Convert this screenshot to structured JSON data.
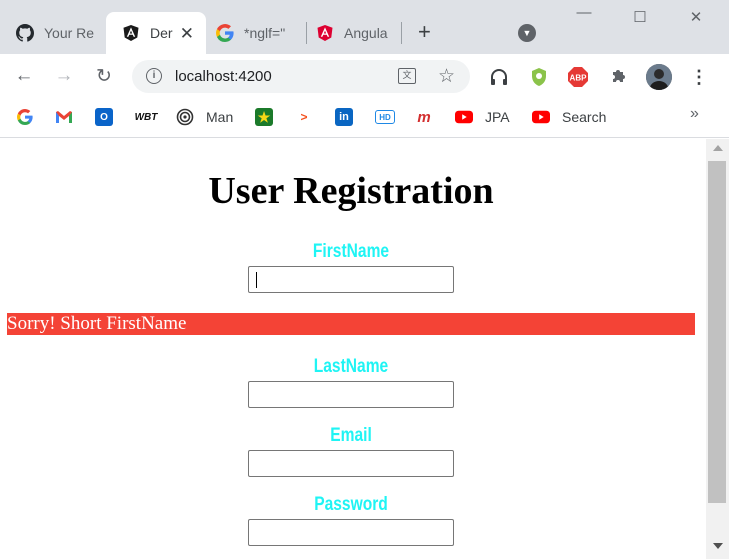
{
  "browser": {
    "tabs": [
      {
        "title": "Your Re",
        "icon": "github-icon"
      },
      {
        "title": "Der",
        "icon": "angular-icon",
        "active": true
      },
      {
        "title": "*nglf=\"",
        "icon": "google-icon"
      },
      {
        "title": "Angula",
        "icon": "angular-red-icon"
      }
    ],
    "address": {
      "url": "localhost:4200"
    },
    "bookmarks": [
      {
        "label": "",
        "icon": "google-icon"
      },
      {
        "label": "",
        "icon": "gmail-icon"
      },
      {
        "label": "",
        "icon": "outlook-icon"
      },
      {
        "label": "",
        "icon": "wbt-icon"
      },
      {
        "label": "Man",
        "icon": "spiral-icon"
      },
      {
        "label": "",
        "icon": "star-badge-icon"
      },
      {
        "label": "",
        "icon": "code-icon"
      },
      {
        "label": "",
        "icon": "linkedin-icon"
      },
      {
        "label": "",
        "icon": "hd-icon"
      },
      {
        "label": "",
        "icon": "m-icon"
      },
      {
        "label": "JPA",
        "icon": "youtube-icon"
      },
      {
        "label": "Search",
        "icon": "youtube-icon"
      }
    ],
    "bookmarks_more": "»"
  },
  "page": {
    "title": "User Registration",
    "fields": {
      "firstname": {
        "label": "FirstName",
        "value": ""
      },
      "lastname": {
        "label": "LastName",
        "value": ""
      },
      "email": {
        "label": "Email",
        "value": ""
      },
      "password": {
        "label": "Password",
        "value": ""
      }
    },
    "error": "Sorry! Short FirstName"
  },
  "colors": {
    "label": "#1ff4f4",
    "error_bg": "#f44336",
    "error_text": "#ffffff"
  }
}
